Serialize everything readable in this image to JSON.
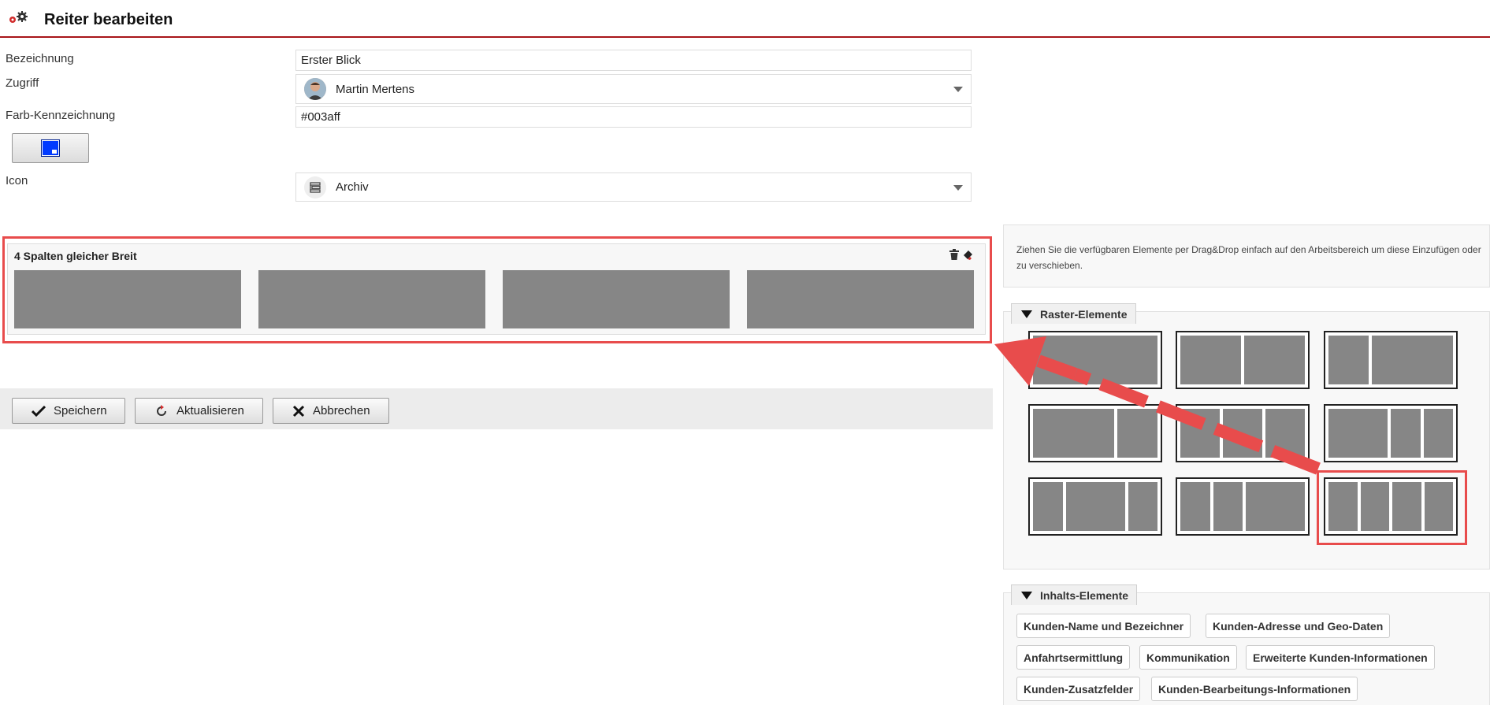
{
  "header": {
    "title": "Reiter bearbeiten",
    "icon": "gears-icon"
  },
  "form": {
    "bezeichnung_label": "Bezeichnung",
    "bezeichnung_value": "Erster Blick",
    "zugriff_label": "Zugriff",
    "zugriff_value": "Martin Mertens",
    "farb_label": "Farb-Kennzeichnung",
    "farb_value": "#003aff",
    "icon_label": "Icon",
    "icon_value": "Archiv"
  },
  "workspace": {
    "row_title": "4 Spalten gleicher Breit",
    "column_count": 4
  },
  "actions": {
    "save": "Speichern",
    "refresh": "Aktualisieren",
    "cancel": "Abbrechen"
  },
  "sidebar": {
    "info": "Ziehen Sie die verfügbaren Elemente per Drag&Drop einfach auf den Arbeitsbereich um diese Einzufügen oder zu verschieben.",
    "raster_title": "Raster-Elemente",
    "inhalts_title": "Inhalts-Elemente",
    "content_elements": [
      "Kunden-Name und Bezeichner",
      "Kunden-Adresse und Geo-Daten",
      "Anfahrtsermittlung",
      "Kommunikation",
      "Erweiterte Kunden-Informationen",
      "Kunden-Zusatzfelder",
      "Kunden-Bearbeitungs-Informationen"
    ]
  },
  "colors": {
    "accent_red": "#a8151a",
    "highlight_red": "#e84c4c",
    "tag_color": "#003aff",
    "block_gray": "#868686"
  }
}
